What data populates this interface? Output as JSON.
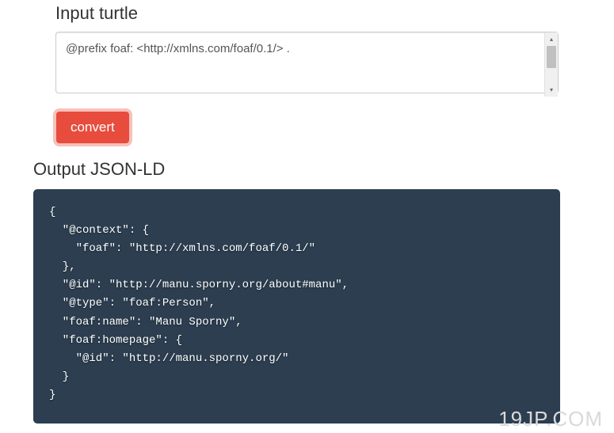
{
  "input": {
    "heading": "Input turtle",
    "value": "@prefix foaf: <http://xmlns.com/foaf/0.1/> ."
  },
  "button": {
    "convert_label": "convert"
  },
  "output": {
    "heading": "Output JSON-LD",
    "code": "{\n  \"@context\": {\n    \"foaf\": \"http://xmlns.com/foaf/0.1/\"\n  },\n  \"@id\": \"http://manu.sporny.org/about#manu\",\n  \"@type\": \"foaf:Person\",\n  \"foaf:name\": \"Manu Sporny\",\n  \"foaf:homepage\": {\n    \"@id\": \"http://manu.sporny.org/\"\n  }\n}"
  },
  "watermark": "19JP.COM"
}
